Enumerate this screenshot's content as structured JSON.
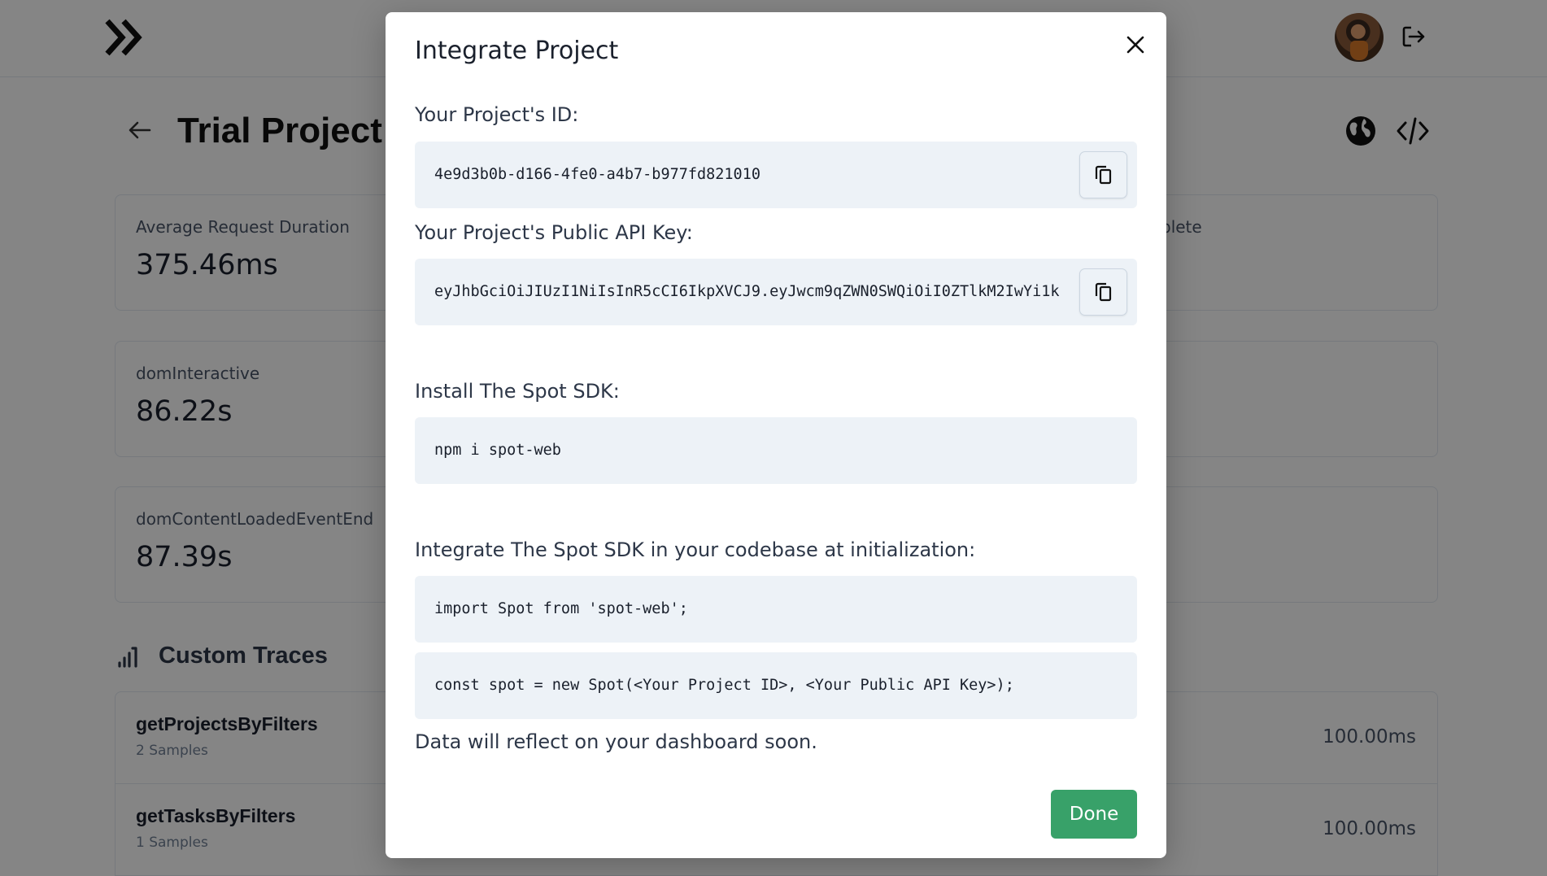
{
  "header": {
    "logo_icon": "double-chevron-right-logo",
    "avatar": "user-avatar",
    "logout_icon": "logout-icon"
  },
  "project": {
    "title": "Trial Project",
    "back_icon": "arrow-left-icon",
    "public_icon": "globe-icon",
    "integrate_icon": "code-icon"
  },
  "metrics": [
    {
      "label": "Average Request Duration",
      "value": "375.46ms",
      "right_label": "plete"
    },
    {
      "label": "domInteractive",
      "value": "86.22s",
      "right_label": ""
    },
    {
      "label": "domContentLoadedEventEnd",
      "value": "87.39s",
      "right_label": ""
    }
  ],
  "traces": {
    "title": "Custom Traces",
    "icon": "bar-chart-icon",
    "items": [
      {
        "name": "getProjectsByFilters",
        "samples": "2 Samples",
        "value": "100.00ms"
      },
      {
        "name": "getTasksByFilters",
        "samples": "1 Samples",
        "value": "100.00ms"
      }
    ]
  },
  "modal": {
    "title": "Integrate Project",
    "close_icon": "close-icon",
    "project_id_label": "Your Project's ID:",
    "project_id": "4e9d3b0b-d166-4fe0-a4b7-b977fd821010",
    "api_key_label": "Your Project's Public API Key:",
    "api_key": "eyJhbGciOiJIUzI1NiIsInR5cCI6IkpXVCJ9.eyJwcm9qZWN0SWQiOiI0ZTlkM2IwYi1k",
    "copy_icon": "copy-icon",
    "install_label": "Install The Spot SDK:",
    "install_cmd": "npm i spot-web",
    "integrate_label": "Integrate The Spot SDK in your codebase at initialization:",
    "import_line": "import Spot from 'spot-web';",
    "init_line": "const spot = new Spot(<Your Project ID>, <Your Public API Key>);",
    "note": "Data will reflect on your dashboard soon.",
    "done_label": "Done"
  },
  "colors": {
    "overlay": "rgba(0,0,0,0.48)",
    "code_bg": "#edf2f7",
    "done_button": "#38a169"
  }
}
